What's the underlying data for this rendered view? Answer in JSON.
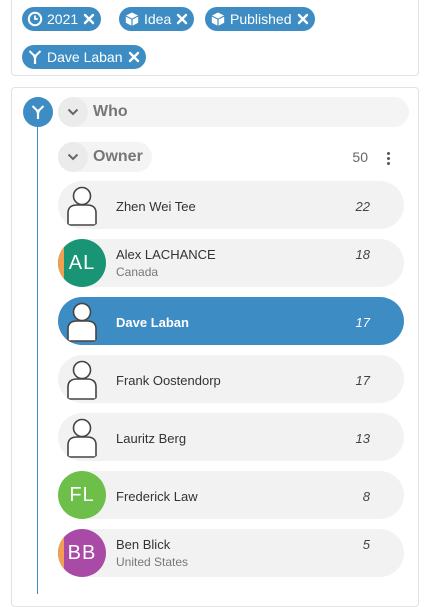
{
  "filters": [
    {
      "label": "2021",
      "icon": "clock-icon"
    },
    {
      "label": "Idea",
      "icon": "cube-icon"
    },
    {
      "label": "Published",
      "icon": "cube-icon"
    },
    {
      "label": "Dave Laban",
      "icon": "antenna-icon"
    }
  ],
  "tree": {
    "group_label": "Who",
    "group_icon": "antenna-icon",
    "owner": {
      "label": "Owner",
      "count": "50"
    },
    "people": [
      {
        "name": "Zhen Wei Tee",
        "sub": "",
        "count": "22",
        "avatar": "placeholder"
      },
      {
        "name": "Alex LACHANCE",
        "sub": "Canada",
        "count": "18",
        "avatar": "initials",
        "initials": "AL",
        "color": "#199575",
        "stripe": "#f0a050"
      },
      {
        "name": "Dave Laban",
        "sub": "",
        "count": "17",
        "avatar": "placeholder",
        "selected": true
      },
      {
        "name": "Frank Oostendorp",
        "sub": "",
        "count": "17",
        "avatar": "placeholder"
      },
      {
        "name": "Lauritz Berg",
        "sub": "",
        "count": "13",
        "avatar": "placeholder"
      },
      {
        "name": "Frederick Law",
        "sub": "",
        "count": "8",
        "avatar": "initials",
        "initials": "FL",
        "color": "#6ebe4a",
        "stripe": ""
      },
      {
        "name": "Ben Blick",
        "sub": "United States",
        "count": "5",
        "avatar": "initials",
        "initials": "BB",
        "color": "#a84aa6",
        "stripe": "#f0a050"
      }
    ]
  },
  "colors": {
    "accent": "#3d8cc4",
    "row_bg": "#f2f2f2"
  }
}
